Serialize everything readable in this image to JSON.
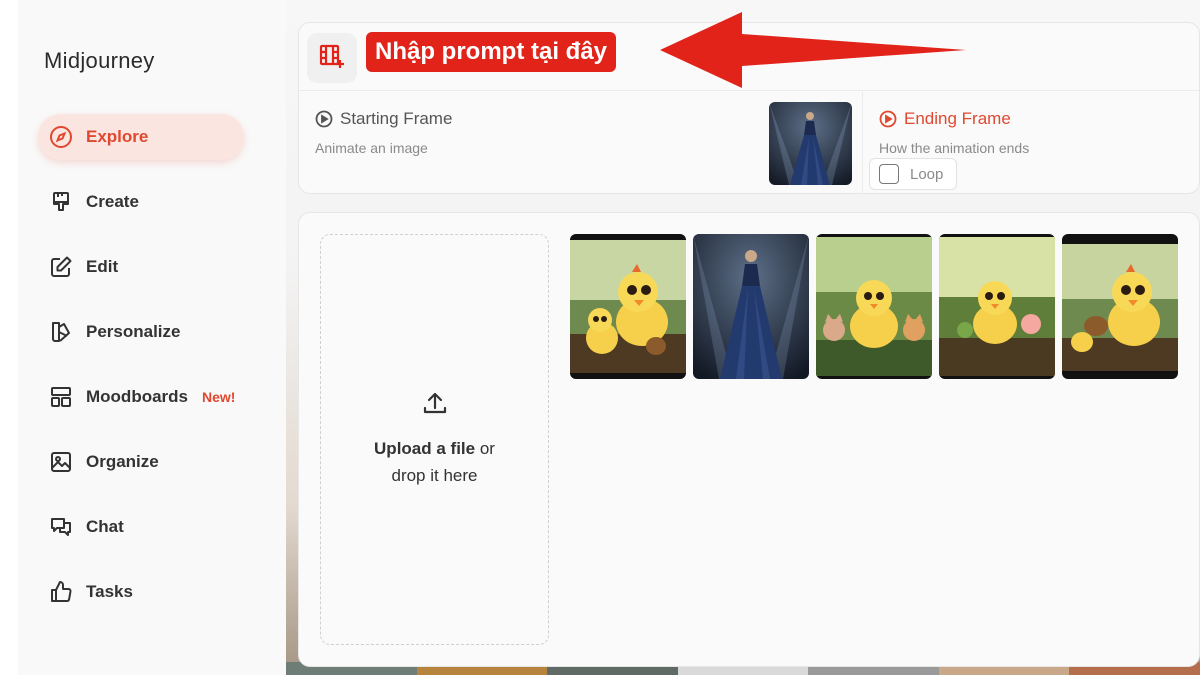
{
  "brand": "Midjourney",
  "nav": [
    {
      "label": "Explore",
      "icon": "compass-icon",
      "active": true
    },
    {
      "label": "Create",
      "icon": "brush-icon"
    },
    {
      "label": "Edit",
      "icon": "edit-icon"
    },
    {
      "label": "Personalize",
      "icon": "personalize-icon"
    },
    {
      "label": "Moodboards",
      "icon": "moodboard-icon",
      "badge": "New!"
    },
    {
      "label": "Organize",
      "icon": "image-icon"
    },
    {
      "label": "Chat",
      "icon": "chat-icon"
    },
    {
      "label": "Tasks",
      "icon": "thumbs-up-icon"
    }
  ],
  "prompt": {
    "callout": "Nhập prompt tại đây"
  },
  "starting_frame": {
    "title": "Starting Frame",
    "subtitle": "Animate an image"
  },
  "ending_frame": {
    "title": "Ending Frame",
    "subtitle": "How the animation ends",
    "loop_label": "Loop"
  },
  "upload": {
    "line1_bold": "Upload a file",
    "line1_rest": " or",
    "line2": "drop it here"
  },
  "gallery": [
    {
      "subject": "chicks-duckling"
    },
    {
      "subject": "fashion-model-blue-gown"
    },
    {
      "subject": "chicks-with-kittens"
    },
    {
      "subject": "chicks-in-forest"
    },
    {
      "subject": "chicks-with-basket"
    }
  ],
  "colors": {
    "accent": "#e0482f",
    "callout_bg": "#e2231a",
    "active_bg": "#fbe5e1"
  }
}
